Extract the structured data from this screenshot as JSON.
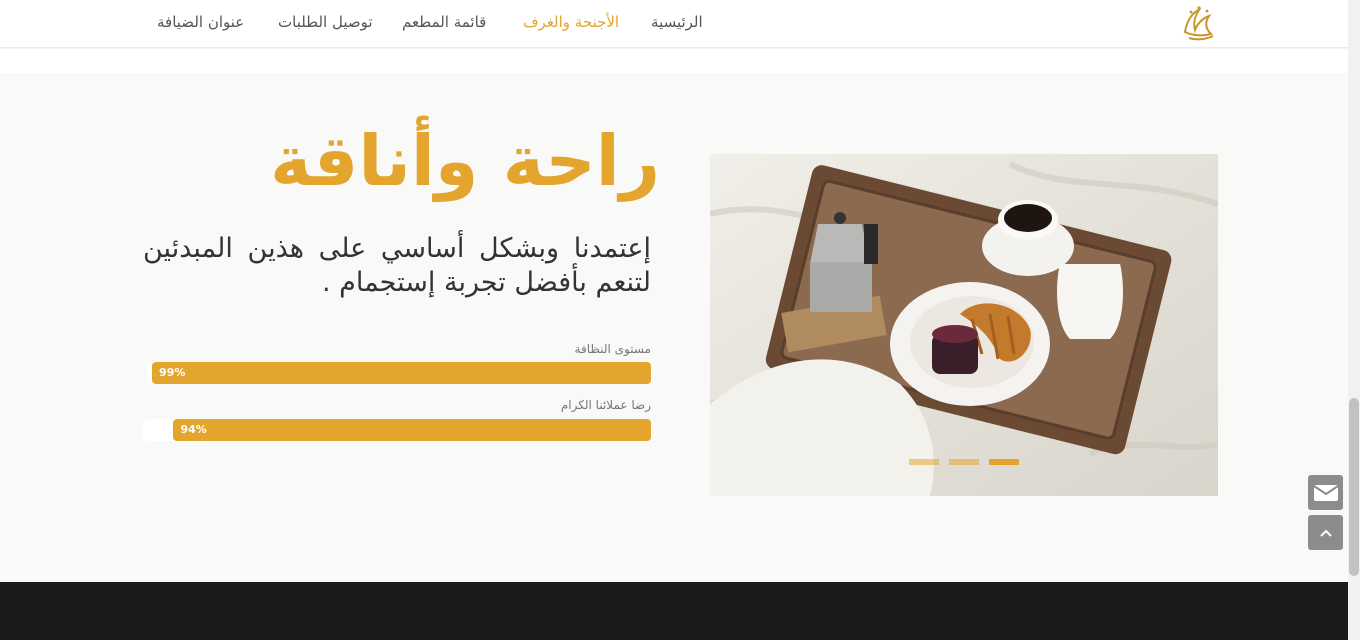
{
  "brand": {
    "logo_text": "الضيافة"
  },
  "nav": {
    "items": [
      {
        "label": "الرئيسية"
      },
      {
        "label": "الأجنحة والغرف"
      },
      {
        "label": "قائمة المطعم"
      },
      {
        "label": "توصيل الطلبات"
      },
      {
        "label": "عنوان الضيافة"
      }
    ],
    "active_index": 1
  },
  "hero": {
    "headline": "راحة وأناقة",
    "paragraph": "إعتمدنا وبشكل أساسي على هذين المبدئين لتنعم بأفضل تجربة إستجمام ."
  },
  "skills": [
    {
      "label": "مستوى النظافة",
      "value_text": "99%",
      "value": 0.99
    },
    {
      "label": "رضا عملائنا الكرام",
      "value_text": "94%",
      "value": 0.94
    }
  ],
  "slider": {
    "slide_count": 3,
    "active_slide": 2
  },
  "colors": {
    "accent": "#e3a52e",
    "footer": "#1a1a1a",
    "text": "#333333"
  },
  "icons": {
    "mail": "envelope-icon",
    "top": "chevron-up-icon"
  }
}
